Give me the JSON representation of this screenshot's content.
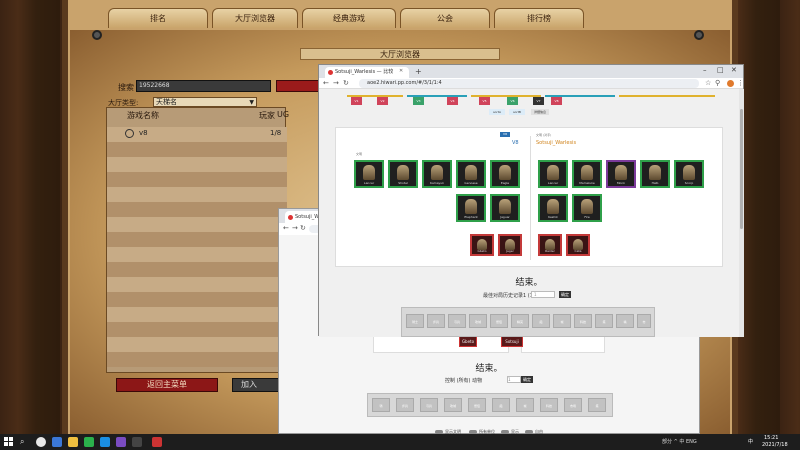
{
  "game": {
    "tabs": [
      "排名",
      "大厅浏览器",
      "经典游戏",
      "公会",
      "排行榜"
    ],
    "title": "大厅浏览器",
    "search": {
      "label": "搜索",
      "value": "19522668"
    },
    "filter": {
      "label": "大厅类型:",
      "selected": "天梯名"
    },
    "list": {
      "headers": {
        "name": "游戏名称",
        "players": "玩家",
        "ugc": "UG"
      },
      "rows": [
        {
          "name": "v8",
          "players": "1/8"
        }
      ]
    },
    "buttons": {
      "return": "返回主菜单",
      "join": "加入"
    }
  },
  "browser_front": {
    "tab_title": "Sotsuji_Warlesis — 比较",
    "address": "aoe2.hiwari.pp.com/#/3/1/1:4",
    "page": {
      "age_chips": [
        "V1",
        "V2",
        "V3",
        "V4",
        "V5",
        "V6",
        "V7",
        "V8"
      ],
      "sub_tabs": [
        "sortA",
        "sortB",
        "详细信息"
      ],
      "left_civ": {
        "tag": "V8",
        "name": "V8",
        "meta": "文明"
      },
      "right_civ": {
        "name": "Sotsuji_Warlesis",
        "meta": "文明 (对手)"
      },
      "left_units": [
        "Lancer",
        "Shotel",
        "Kamayuk",
        "Genoese",
        "Eagle",
        "Elephant",
        "Jaguar"
      ],
      "left_special": [
        "Gbeto",
        "Jager"
      ],
      "right_units": [
        "Lancer",
        "Mameluke",
        "Monk",
        "Halb",
        "Scorp",
        "Keshik",
        "Fire"
      ],
      "right_special": [
        "Raider",
        "Cata"
      ],
      "heading": "结束。",
      "form_label": "最佳对局历史记录1 (1) 按钮",
      "form_input": "1",
      "form_button": "确定",
      "icons": [
        "骑士",
        "步兵",
        "弓兵",
        "攻城",
        "僧侣",
        "精英",
        "船",
        "城",
        "科技",
        "塔",
        "墙",
        "市"
      ]
    }
  },
  "browser_back": {
    "tab_title": "Sotsuji_W…",
    "page": {
      "unit_a": "Gbeto",
      "unit_b": "Sotsuji",
      "heading": "结束。",
      "form_label": "控制 (所有) 动物",
      "form_input": "1",
      "form_button": "确定",
      "icons": [
        "骑",
        "步兵",
        "弓兵",
        "攻城",
        "僧侣",
        "船",
        "城",
        "科技",
        "市场",
        "塔"
      ],
      "toggles": [
        "显示文明",
        "所有单位",
        "显示",
        "自由"
      ]
    }
  },
  "taskbar": {
    "tray": "部分 ^ 中 ENG",
    "lang": "中",
    "time": "15:21",
    "date": "2021/7/18"
  }
}
